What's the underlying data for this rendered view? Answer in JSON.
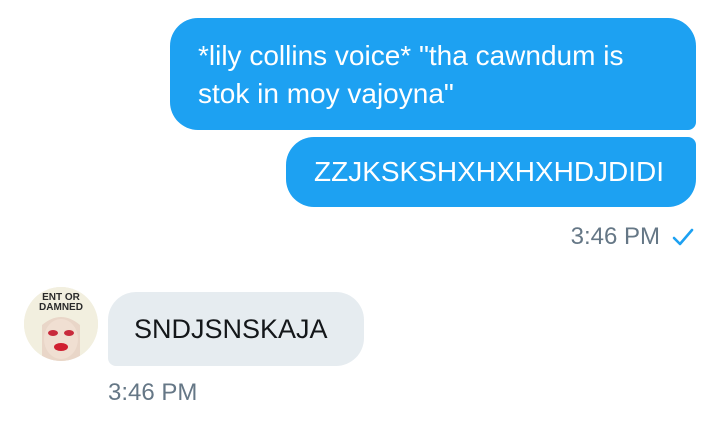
{
  "outgoing": {
    "messages": [
      {
        "text": "*lily collins voice* \"tha cawndum is stok in moy vajoyna\""
      },
      {
        "text": "ZZJKSKSHXHXHXHDJDIDI"
      }
    ],
    "timestamp": "3:46 PM",
    "status_icon": "checkmark-icon"
  },
  "incoming": {
    "avatar": {
      "lines": [
        "ENT OR",
        "DAMNED"
      ]
    },
    "messages": [
      {
        "text": "SNDJSNSKAJA"
      }
    ],
    "timestamp": "3:46 PM"
  },
  "colors": {
    "outgoing_bubble": "#1da1f2",
    "incoming_bubble": "#e6ecf0",
    "timestamp": "#657786",
    "check": "#1da1f2"
  }
}
